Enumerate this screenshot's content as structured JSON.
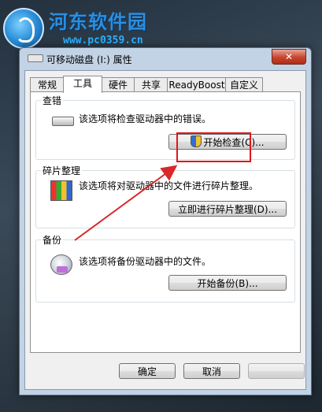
{
  "watermark": {
    "title": "河东软件园",
    "url": "www.pc0359.cn"
  },
  "window": {
    "title": "可移动磁盘 (I:) 属性",
    "close_label": "✕"
  },
  "tabs": [
    {
      "label": "常规",
      "active": false
    },
    {
      "label": "工具",
      "active": true
    },
    {
      "label": "硬件",
      "active": false
    },
    {
      "label": "共享",
      "active": false
    },
    {
      "label": "ReadyBoost",
      "active": false
    },
    {
      "label": "自定义",
      "active": false
    }
  ],
  "groups": {
    "error_check": {
      "label": "查错",
      "description": "该选项将检查驱动器中的错误。",
      "button": "开始检查(C)...",
      "icon": "drive-icon"
    },
    "defrag": {
      "label": "碎片整理",
      "description": "该选项将对驱动器中的文件进行碎片整理。",
      "button": "立即进行碎片整理(D)...",
      "icon": "defrag-icon"
    },
    "backup": {
      "label": "备份",
      "description": "该选项将备份驱动器中的文件。",
      "button": "开始备份(B)...",
      "icon": "backup-icon"
    }
  },
  "footer": {
    "ok": "确定",
    "cancel": "取消",
    "apply": ""
  },
  "colors": {
    "highlight": "#e0161a",
    "arrow": "#d8282a",
    "title_bar": "#c3d3e6"
  }
}
